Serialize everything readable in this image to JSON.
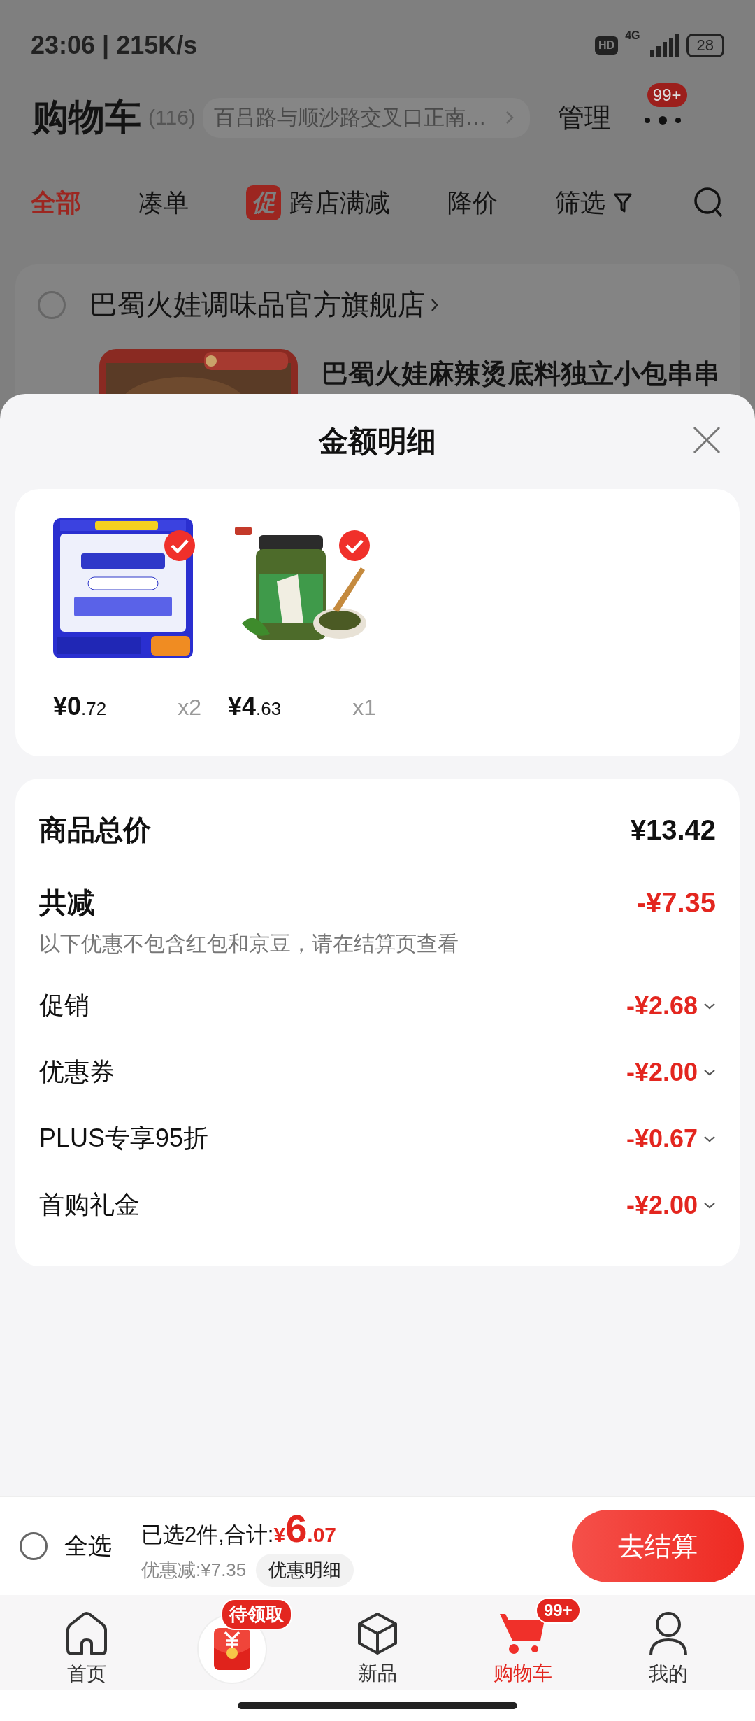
{
  "status_bar": {
    "time": "23:06 | 215K/s",
    "hd": "HD",
    "network": "4G",
    "battery": "28"
  },
  "header": {
    "title": "购物车",
    "count": "(116)",
    "address": "百吕路与顺沙路交叉口正南…",
    "manage": "管理",
    "more_badge": "99+"
  },
  "tabs": [
    {
      "label": "全部",
      "selected": true,
      "kind": "plain"
    },
    {
      "label": "凑单",
      "selected": false,
      "kind": "plain"
    },
    {
      "label": "跨店满减",
      "selected": false,
      "kind": "promo",
      "badge": "促"
    },
    {
      "label": "降价",
      "selected": false,
      "kind": "plain"
    },
    {
      "label": "筛选",
      "selected": false,
      "kind": "filter"
    }
  ],
  "store": {
    "name": "巴蜀火娃调味品官方旗舰店",
    "checked": false,
    "product_title": "巴蜀火娃麻辣烫底料独立小包串串"
  },
  "sheet": {
    "title": "金额明细",
    "items": [
      {
        "price_main": "¥0",
        "price_cents": ".72",
        "quantity": "x2",
        "checked": true
      },
      {
        "price_main": "¥4",
        "price_cents": ".63",
        "quantity": "x1",
        "checked": true
      }
    ],
    "total": {
      "label": "商品总价",
      "value": "¥13.42"
    },
    "reduction": {
      "label": "共减",
      "value": "-¥7.35",
      "note": "以下优惠不包含红包和京豆，请在结算页查看"
    },
    "discounts": [
      {
        "label": "促销",
        "value": "-¥2.68",
        "expanded": false
      },
      {
        "label": "优惠券",
        "value": "-¥2.00",
        "expanded": false
      },
      {
        "label": "PLUS专享95折",
        "value": "-¥0.67",
        "expanded": false
      },
      {
        "label": "首购礼金",
        "value": "-¥2.00",
        "expanded": false
      }
    ]
  },
  "checkout": {
    "select_all": {
      "label": "全选",
      "checked": false
    },
    "selected_text": "已选2件,合计:",
    "currency": "¥",
    "amount_main": "6",
    "amount_cents": ".07",
    "saving": "优惠减:¥7.35",
    "detail_button": "优惠明细",
    "button": "去结算"
  },
  "nav": [
    {
      "kind": "home",
      "label": "首页",
      "selected": false
    },
    {
      "kind": "coupon",
      "badge": "待领取",
      "selected": false
    },
    {
      "kind": "new",
      "label": "新品",
      "selected": false
    },
    {
      "kind": "cart",
      "label": "购物车",
      "selected": true,
      "badge": "99+"
    },
    {
      "kind": "profile",
      "label": "我的",
      "selected": false
    }
  ]
}
